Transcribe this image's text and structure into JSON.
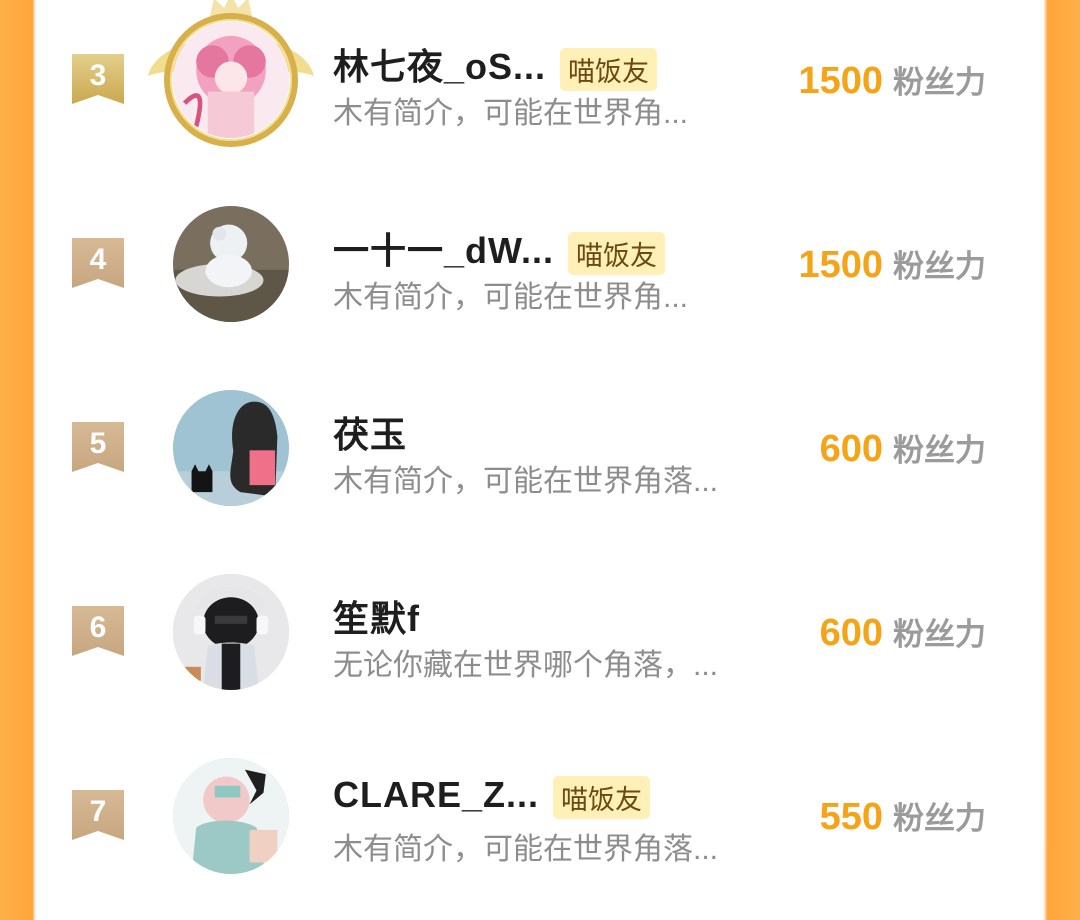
{
  "entries": [
    {
      "rank": "3",
      "name": "林七夜_oS...",
      "tag": "喵饭友",
      "bio": "木有简介，可能在世界角...",
      "score": "1500",
      "unit": "粉丝力"
    },
    {
      "rank": "4",
      "name": "一十一_dW...",
      "tag": "喵饭友",
      "bio": "木有简介，可能在世界角...",
      "score": "1500",
      "unit": "粉丝力"
    },
    {
      "rank": "5",
      "name": "茯玉",
      "tag": "",
      "bio": "木有简介，可能在世界角落...",
      "score": "600",
      "unit": "粉丝力"
    },
    {
      "rank": "6",
      "name": "笙默f",
      "tag": "",
      "bio": "无论你藏在世界哪个角落，...",
      "score": "600",
      "unit": "粉丝力"
    },
    {
      "rank": "7",
      "name": "CLARE_Z...",
      "tag": "喵饭友",
      "bio": "木有简介，可能在世界角落...",
      "score": "550",
      "unit": "粉丝力"
    }
  ],
  "colors": {
    "accent": "#f5a418",
    "frame": "#ffa53a",
    "tag_bg": "#fff0b8"
  }
}
